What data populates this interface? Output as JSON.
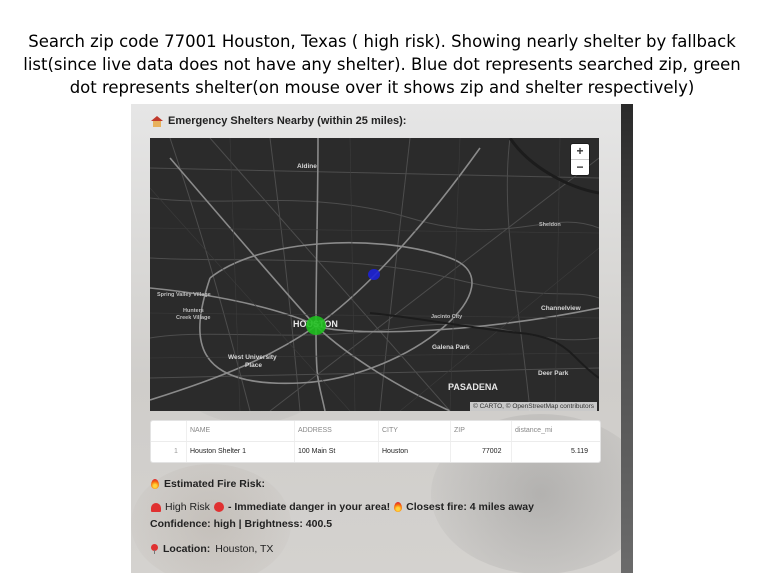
{
  "caption": {
    "line1": "Search zip code 77001 Houston, Texas ( high risk). Showing nearly shelter by fallback",
    "line2": "list(since live data does not have any shelter). Blue dot represents searched zip, green",
    "line3": "dot represents shelter(on mouse over it shows zip and shelter respectively)"
  },
  "shelters": {
    "title": "Emergency Shelters Nearby (within 25 miles):",
    "icon": "house-icon"
  },
  "map": {
    "labels": {
      "aldine": "Aldine",
      "sheldon": "Sheldon",
      "spring_valley": "Spring Valley Village",
      "hunters_creek_1": "Hunters",
      "hunters_creek_2": "Creek Village",
      "houston": "HOUSTON",
      "jacinto_city": "Jacinto City",
      "channelview": "Channelview",
      "galena_park": "Galena Park",
      "west_university_1": "West University",
      "west_university_2": "Place",
      "pasadena": "PASADENA",
      "deer_park": "Deer Park"
    },
    "zoom_in": "+",
    "zoom_out": "−",
    "attribution": "© CARTO, © OpenStreetMap contributors",
    "colors": {
      "background": "#2b2b2b",
      "searched_zip_dot": "#1d22d6",
      "shelter_dot": "#1fbf1f"
    }
  },
  "table": {
    "columns": [
      "",
      "NAME",
      "ADDRESS",
      "CITY",
      "ZIP",
      "distance_mi"
    ],
    "rows": [
      [
        "1",
        "Houston Shelter 1",
        "100 Main St",
        "Houston",
        "77002",
        "5.119"
      ]
    ]
  },
  "fire": {
    "title": "Estimated Fire Risk:",
    "risk_label": "High Risk",
    "risk_message": "- Immediate danger in your area!",
    "closest_fire": "Closest fire: 4 miles away",
    "confidence": "Confidence: high | Brightness: 400.5"
  },
  "location": {
    "label": "Location:",
    "value": "Houston, TX"
  }
}
